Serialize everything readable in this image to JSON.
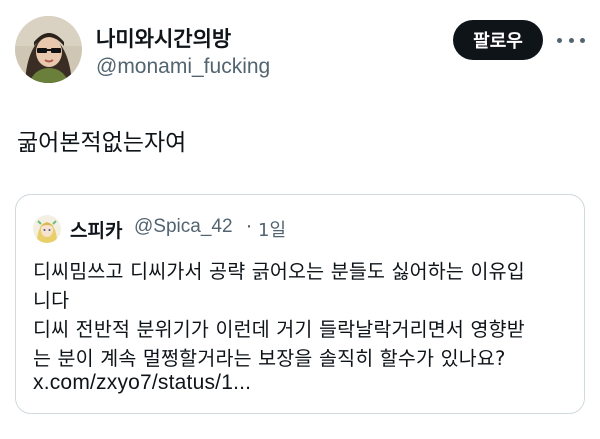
{
  "author": {
    "display_name": "나미와시간의방",
    "handle": "@monami_fucking"
  },
  "actions": {
    "follow_label": "팔로우",
    "more_icon": "more-horizontal-icon"
  },
  "tweet": {
    "text": "굶어본적없는자여"
  },
  "quoted_tweet": {
    "display_name": "스피카",
    "handle": "@Spica_42",
    "separator": "·",
    "time": "1일",
    "lines": [
      "디씨밈쓰고 디씨가서 공략 긁어오는 분들도 싫어하는 이유입",
      "니다",
      "디씨 전반적 분위기가 이런데 거기 들락날락거리면서 영향받",
      "는 분이 계속 멀쩡할거라는 보장을 솔직히 할수가 있나요?",
      "x.com/zxyo7/status/1..."
    ]
  },
  "colors": {
    "text_primary": "#0f1419",
    "text_secondary": "#536471",
    "button_bg": "#0f1419",
    "border": "#cfd9de"
  }
}
